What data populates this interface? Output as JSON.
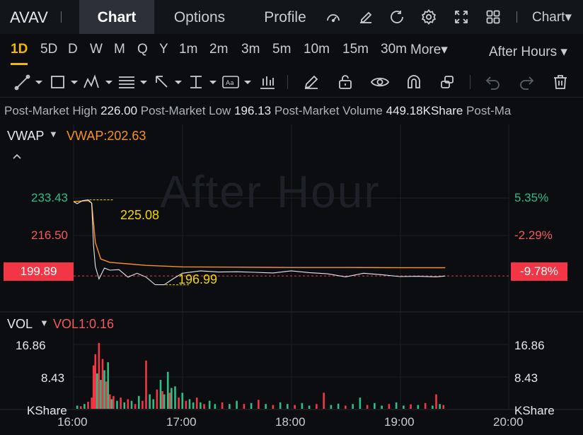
{
  "header": {
    "ticker": "AVAV",
    "tabs": [
      {
        "label": "Chart",
        "active": true
      },
      {
        "label": "Options",
        "active": false
      },
      {
        "label": "Profile",
        "active": false
      }
    ],
    "icons": [
      "gauge-icon",
      "edit-icon",
      "refresh-icon",
      "settings-icon",
      "fullscreen-icon",
      "layout-grid-icon"
    ],
    "chart_menu": "Chart▾"
  },
  "periods": {
    "items": [
      "1D",
      "5D",
      "D",
      "W",
      "M",
      "Q",
      "Y",
      "1m",
      "2m",
      "3m",
      "5m",
      "10m",
      "15m",
      "30m"
    ],
    "active": "1D",
    "more": "More▾",
    "session": "After Hours ▾"
  },
  "toolbar": {
    "icons": [
      "trend-line-icon",
      "rectangle-icon",
      "pattern-icon",
      "fib-icon",
      "arrow-icon",
      "measure-icon",
      "text-icon",
      "indicator-icon",
      "pencil-icon",
      "lock-icon",
      "eye-icon",
      "magnet-icon",
      "link-icon",
      "undo-icon",
      "redo-icon",
      "trash-icon"
    ]
  },
  "info": {
    "items": [
      {
        "label": "Post-Market High",
        "value": "226.00"
      },
      {
        "label": "Post-Market Low",
        "value": "196.13"
      },
      {
        "label": "Post-Market Volume",
        "value": "449.18KShare"
      },
      {
        "label": "Post-Ma",
        "value": ""
      }
    ]
  },
  "price_pane": {
    "indicator_name": "VWAP",
    "indicator_value": "VWAP:202.63",
    "watermark": "After Hour",
    "left_labels": [
      "233.43",
      "216.50"
    ],
    "right_labels": [
      "5.35%",
      "-2.29%"
    ],
    "current_price": "199.89",
    "current_pct": "-9.78%",
    "high_annotation": "225.08",
    "low_annotation": "196.99"
  },
  "volume_pane": {
    "indicator_name": "VOL",
    "indicator_value": "VOL1:0.16",
    "left_labels": [
      "16.86",
      "8.43",
      "KShare"
    ],
    "right_labels": [
      "16.86",
      "8.43",
      "KShare"
    ]
  },
  "x_axis": [
    "16:00",
    "17:00",
    "18:00",
    "19:00",
    "20:00"
  ],
  "colors": {
    "up": "#2ebd85",
    "down": "#f23645",
    "vwap": "#f7921e",
    "price": "#e6e8eb",
    "accent": "#f2b900"
  },
  "chart_data": {
    "type": "line",
    "x_range": [
      "16:00",
      "20:00"
    ],
    "price": {
      "x": [
        "16:00",
        "16:02",
        "16:05",
        "16:08",
        "16:10",
        "16:11",
        "16:12",
        "16:14",
        "16:17",
        "16:20",
        "16:25",
        "16:30",
        "16:35",
        "16:40",
        "16:45",
        "16:50",
        "16:55",
        "17:00",
        "17:10",
        "17:20",
        "17:30",
        "17:40",
        "17:50",
        "18:00",
        "18:10",
        "18:20",
        "18:30",
        "18:40",
        "18:50",
        "19:00",
        "19:10",
        "19:20",
        "19:25"
      ],
      "values": [
        224.5,
        223.8,
        224.8,
        225.08,
        224.0,
        210.0,
        203.0,
        198.9,
        202.5,
        201.8,
        202.0,
        199.5,
        200.8,
        199.5,
        197.0,
        196.99,
        199.0,
        200.8,
        201.6,
        201.2,
        201.3,
        201.1,
        200.9,
        201.6,
        201.0,
        200.6,
        199.6,
        200.8,
        200.3,
        199.7,
        199.8,
        199.6,
        199.89
      ]
    },
    "vwap": {
      "x": [
        "16:00",
        "16:08",
        "16:10",
        "16:12",
        "16:15",
        "16:20",
        "16:30",
        "16:40",
        "17:00",
        "17:30",
        "18:00",
        "18:30",
        "19:00",
        "19:25"
      ],
      "values": [
        224.5,
        224.8,
        224.0,
        211.0,
        205.5,
        204.4,
        203.9,
        203.4,
        202.9,
        202.8,
        202.7,
        202.7,
        202.65,
        202.63
      ]
    },
    "y_range": [
      188,
      250
    ],
    "annotations": [
      {
        "label": "225.08",
        "value": 225.08
      },
      {
        "label": "196.99",
        "value": 196.99
      }
    ],
    "volume": {
      "y_range": [
        0,
        22
      ],
      "bars": [
        {
          "t": "16:02",
          "v": 1.0,
          "up": true
        },
        {
          "t": "16:04",
          "v": 0.8,
          "up": false
        },
        {
          "t": "16:06",
          "v": 1.5,
          "up": true
        },
        {
          "t": "16:08",
          "v": 2.2,
          "up": false
        },
        {
          "t": "16:10",
          "v": 3.5,
          "up": false
        },
        {
          "t": "16:11",
          "v": 13.5,
          "up": false
        },
        {
          "t": "16:12",
          "v": 17.0,
          "up": false
        },
        {
          "t": "16:13",
          "v": 11.0,
          "up": true
        },
        {
          "t": "16:14",
          "v": 20.5,
          "up": false
        },
        {
          "t": "16:15",
          "v": 9.0,
          "up": true
        },
        {
          "t": "16:16",
          "v": 15.5,
          "up": false
        },
        {
          "t": "16:17",
          "v": 12.0,
          "up": true
        },
        {
          "t": "16:18",
          "v": 8.5,
          "up": false
        },
        {
          "t": "16:19",
          "v": 14.5,
          "up": true
        },
        {
          "t": "16:20",
          "v": 4.5,
          "up": false
        },
        {
          "t": "16:21",
          "v": 3.0,
          "up": true
        },
        {
          "t": "16:22",
          "v": 4.0,
          "up": false
        },
        {
          "t": "16:24",
          "v": 2.5,
          "up": true
        },
        {
          "t": "16:26",
          "v": 3.5,
          "up": false
        },
        {
          "t": "16:28",
          "v": 2.0,
          "up": true
        },
        {
          "t": "16:30",
          "v": 3.0,
          "up": false
        },
        {
          "t": "16:32",
          "v": 2.5,
          "up": true
        },
        {
          "t": "16:34",
          "v": 1.5,
          "up": false
        },
        {
          "t": "16:36",
          "v": 4.0,
          "up": true
        },
        {
          "t": "16:38",
          "v": 2.5,
          "up": false
        },
        {
          "t": "16:40",
          "v": 15.0,
          "up": false
        },
        {
          "t": "16:42",
          "v": 4.5,
          "up": true
        },
        {
          "t": "16:44",
          "v": 3.0,
          "up": true
        },
        {
          "t": "16:46",
          "v": 6.0,
          "up": false
        },
        {
          "t": "16:48",
          "v": 9.0,
          "up": true
        },
        {
          "t": "16:49",
          "v": 5.5,
          "up": false
        },
        {
          "t": "16:50",
          "v": 4.5,
          "up": true
        },
        {
          "t": "16:52",
          "v": 11.5,
          "up": true
        },
        {
          "t": "16:53",
          "v": 5.0,
          "up": false
        },
        {
          "t": "16:54",
          "v": 6.5,
          "up": true
        },
        {
          "t": "16:56",
          "v": 7.0,
          "up": true
        },
        {
          "t": "16:58",
          "v": 3.5,
          "up": false
        },
        {
          "t": "17:00",
          "v": 5.0,
          "up": true
        },
        {
          "t": "17:02",
          "v": 2.5,
          "up": false
        },
        {
          "t": "17:04",
          "v": 3.0,
          "up": true
        },
        {
          "t": "17:06",
          "v": 2.0,
          "up": true
        },
        {
          "t": "17:08",
          "v": 3.5,
          "up": false
        },
        {
          "t": "17:10",
          "v": 2.0,
          "up": true
        },
        {
          "t": "17:12",
          "v": 1.5,
          "up": false
        },
        {
          "t": "17:15",
          "v": 2.5,
          "up": true
        },
        {
          "t": "17:18",
          "v": 1.5,
          "up": true
        },
        {
          "t": "17:22",
          "v": 2.0,
          "up": false
        },
        {
          "t": "17:26",
          "v": 1.5,
          "up": true
        },
        {
          "t": "17:30",
          "v": 2.5,
          "up": true
        },
        {
          "t": "17:34",
          "v": 1.5,
          "up": false
        },
        {
          "t": "17:38",
          "v": 1.8,
          "up": true
        },
        {
          "t": "17:42",
          "v": 2.8,
          "up": false
        },
        {
          "t": "17:46",
          "v": 1.5,
          "up": true
        },
        {
          "t": "17:50",
          "v": 1.2,
          "up": false
        },
        {
          "t": "17:54",
          "v": 2.0,
          "up": true
        },
        {
          "t": "17:58",
          "v": 1.5,
          "up": true
        },
        {
          "t": "18:02",
          "v": 1.2,
          "up": false
        },
        {
          "t": "18:06",
          "v": 1.8,
          "up": true
        },
        {
          "t": "18:10",
          "v": 1.0,
          "up": true
        },
        {
          "t": "18:14",
          "v": 1.5,
          "up": false
        },
        {
          "t": "18:18",
          "v": 5.0,
          "up": false
        },
        {
          "t": "18:22",
          "v": 1.2,
          "up": true
        },
        {
          "t": "18:26",
          "v": 1.6,
          "up": true
        },
        {
          "t": "18:30",
          "v": 1.0,
          "up": false
        },
        {
          "t": "18:34",
          "v": 1.5,
          "up": true
        },
        {
          "t": "18:38",
          "v": 3.5,
          "up": true
        },
        {
          "t": "18:42",
          "v": 1.2,
          "up": false
        },
        {
          "t": "18:46",
          "v": 1.8,
          "up": true
        },
        {
          "t": "18:50",
          "v": 1.0,
          "up": true
        },
        {
          "t": "18:54",
          "v": 1.5,
          "up": false
        },
        {
          "t": "18:58",
          "v": 2.0,
          "up": true
        },
        {
          "t": "19:02",
          "v": 1.0,
          "up": true
        },
        {
          "t": "19:06",
          "v": 1.4,
          "up": false
        },
        {
          "t": "19:10",
          "v": 1.2,
          "up": true
        },
        {
          "t": "19:14",
          "v": 1.8,
          "up": false
        },
        {
          "t": "19:18",
          "v": 1.0,
          "up": true
        },
        {
          "t": "19:20",
          "v": 4.5,
          "up": false
        },
        {
          "t": "19:22",
          "v": 1.5,
          "up": true
        },
        {
          "t": "19:24",
          "v": 1.2,
          "up": false
        }
      ]
    }
  }
}
